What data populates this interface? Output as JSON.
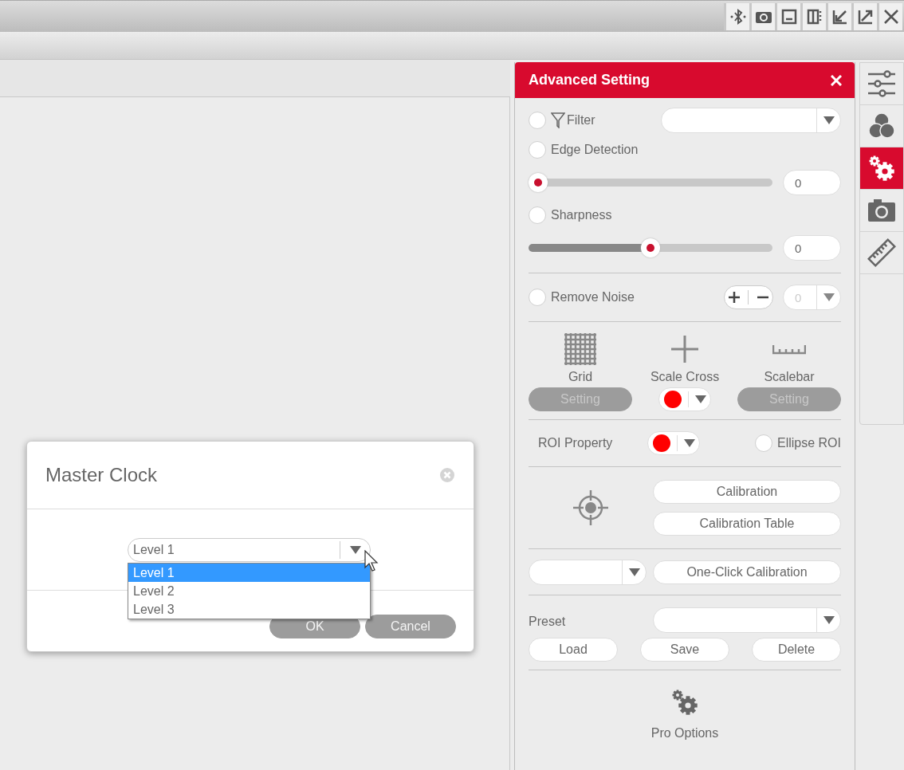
{
  "panel": {
    "title": "Advanced Setting",
    "filter": {
      "label": "Filter",
      "checked": false
    },
    "edge_detection": {
      "label": "Edge Detection",
      "checked": false,
      "level": 0,
      "value": "0"
    },
    "sharpness": {
      "label": "Sharpness",
      "checked": false,
      "level": 0.5,
      "value": "0"
    },
    "remove_noise": {
      "label": "Remove Noise",
      "checked": false,
      "value": "0",
      "disabled": true
    },
    "overlays": [
      {
        "kind": "grid",
        "label": "Grid",
        "button": "Setting",
        "disabled": true
      },
      {
        "kind": "cross",
        "label": "Scale Cross",
        "color": "#ff0000"
      },
      {
        "kind": "scalebar",
        "label": "Scalebar",
        "button": "Setting",
        "disabled": true
      }
    ],
    "roi": {
      "label": "ROI Property",
      "color": "#ff0000",
      "ellipse": {
        "label": "Ellipse ROI",
        "checked": false
      }
    },
    "calibration": {
      "buttons": [
        "Calibration",
        "Calibration Table"
      ],
      "one_click": "One-Click Calibration"
    },
    "preset": {
      "label": "Preset",
      "buttons": [
        "Load",
        "Save",
        "Delete"
      ]
    },
    "pro_options": "Pro Options"
  },
  "side_tabs": [
    {
      "kind": "sliders",
      "selected": false
    },
    {
      "kind": "colors",
      "selected": false
    },
    {
      "kind": "gears",
      "selected": true
    },
    {
      "kind": "camera",
      "selected": false
    },
    {
      "kind": "ruler",
      "selected": false
    }
  ],
  "dialog": {
    "title": "Master Clock",
    "select": {
      "value": "Level 1"
    },
    "options": [
      {
        "label": "Level 1",
        "selected": true
      },
      {
        "label": "Level 2",
        "selected": false
      },
      {
        "label": "Level 3",
        "selected": false
      }
    ],
    "buttons": [
      "OK",
      "Cancel"
    ]
  }
}
